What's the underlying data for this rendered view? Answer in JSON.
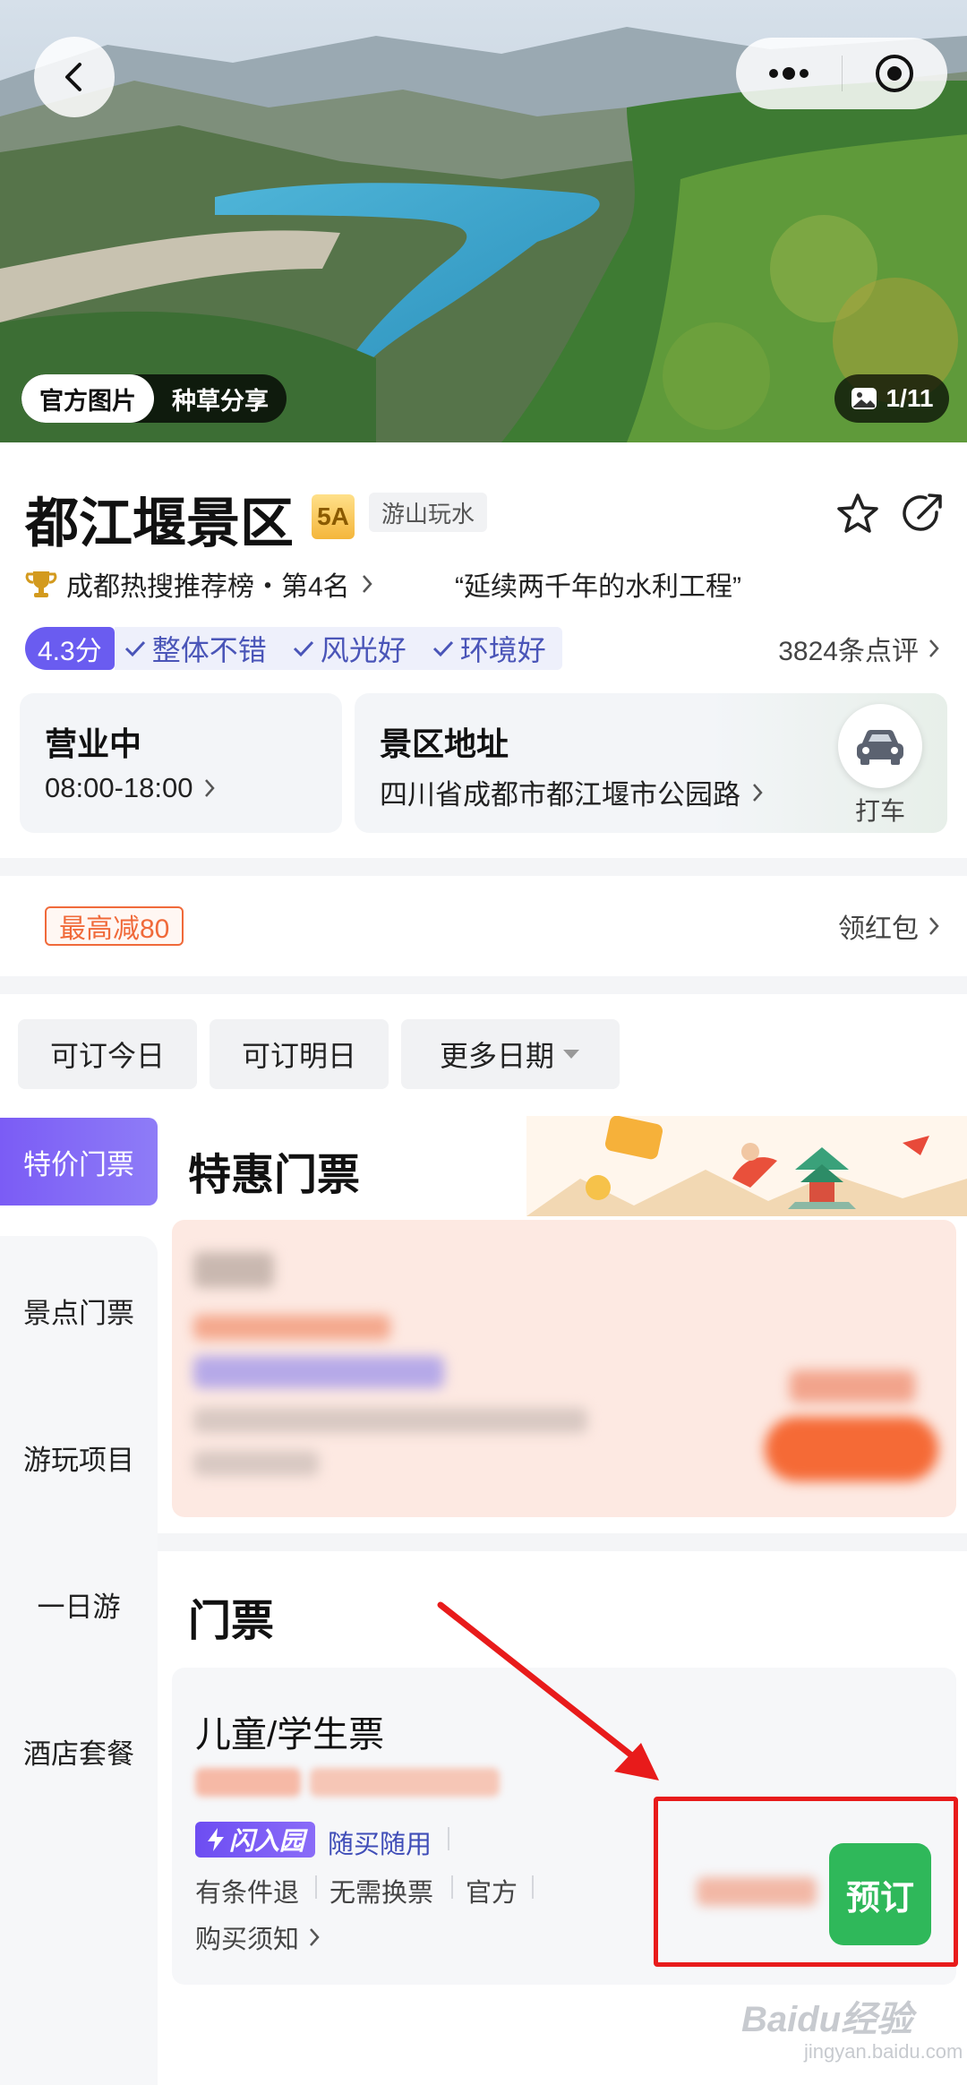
{
  "hero": {
    "tabs": [
      "官方图片",
      "种草分享"
    ],
    "counter": "1/11"
  },
  "poi": {
    "title": "都江堰景区",
    "level_badge": "5A",
    "category_tag": "游山玩水",
    "rank_text": "成都热搜推荐榜・第4名",
    "quote": "“延续两千年的水利工程”",
    "score": "4.3分",
    "highlights": [
      "整体不错",
      "风光好",
      "环境好"
    ],
    "review_count": "3824条点评"
  },
  "hours": {
    "status": "营业中",
    "time": "08:00-18:00"
  },
  "address": {
    "heading": "景区地址",
    "value": "四川省成都市都江堰市公园路",
    "taxi_label": "打车"
  },
  "promo": {
    "coupon": "最高减80",
    "redpack": "领红包"
  },
  "date_filters": [
    "可订今日",
    "可订明日",
    "更多日期"
  ],
  "side_nav": [
    "特价门票",
    "景点门票",
    "游玩项目",
    "一日游",
    "酒店套餐"
  ],
  "sections": {
    "special": {
      "title": "特惠门票"
    },
    "tickets": {
      "title": "门票",
      "item": {
        "name": "儿童/学生票",
        "flash_badge": "闪入园",
        "buy_use": "随买随用",
        "features": [
          "有条件退",
          "无需换票",
          "官方"
        ],
        "notice": "购买须知",
        "book_label": "预订"
      }
    }
  },
  "watermark": {
    "brand": "Baidu经验",
    "site": "jingyan.baidu.com"
  },
  "colors": {
    "accent": "#6a5cf0",
    "book": "#2fb85a",
    "coupon": "#f06a3a",
    "annotation": "#e81b1b"
  }
}
